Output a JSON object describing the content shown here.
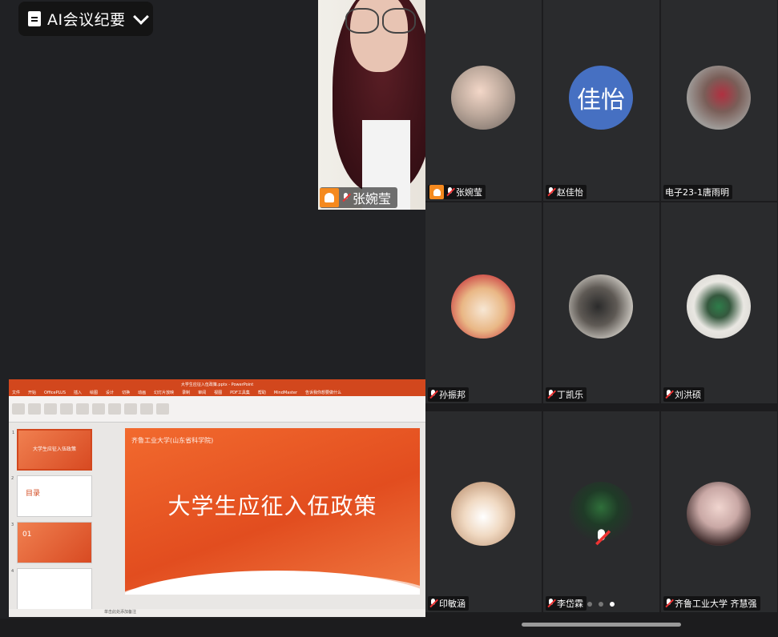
{
  "ai_summary": {
    "label": "AI会议纪要"
  },
  "active_speaker": {
    "name": "张婉莹"
  },
  "presentation": {
    "window_title": "大学生应征入伍政策.pptx - PowerPoint",
    "ribbon_tabs": [
      "文件",
      "开始",
      "OfficePLUS",
      "插入",
      "绘图",
      "设计",
      "切换",
      "动画",
      "幻灯片放映",
      "录制",
      "审阅",
      "视图",
      "PDF工具集",
      "帮助",
      "MindMaster",
      "告诉我你想要做什么"
    ],
    "slide_title": "大学生应征入伍政策",
    "slide_logo": "齐鲁工业大学(山东省科学院)",
    "notes_placeholder": "单击此处添加备注",
    "thumb_texts": [
      "大学生应征入伍政策",
      "目录",
      "01"
    ]
  },
  "participants": [
    {
      "name": "张婉莹",
      "avatar": "photo-girl",
      "host": true
    },
    {
      "name": "赵佳怡",
      "avatar_text": "佳怡"
    },
    {
      "name": "电子23-1唐雨明",
      "avatar": "photo-stairs"
    },
    {
      "name": "孙振邦",
      "avatar": "cartoon"
    },
    {
      "name": "丁凯乐",
      "avatar": "photo-man"
    },
    {
      "name": "刘洪硕",
      "avatar": "toy"
    },
    {
      "name": "印敏涵",
      "avatar": "cat"
    },
    {
      "name": "李岱霖",
      "avatar": "celtics-logo"
    },
    {
      "name": "齐鲁工业大学 齐慧强",
      "avatar": "photo-woman"
    }
  ],
  "pager": {
    "total": 3,
    "current": 3
  }
}
